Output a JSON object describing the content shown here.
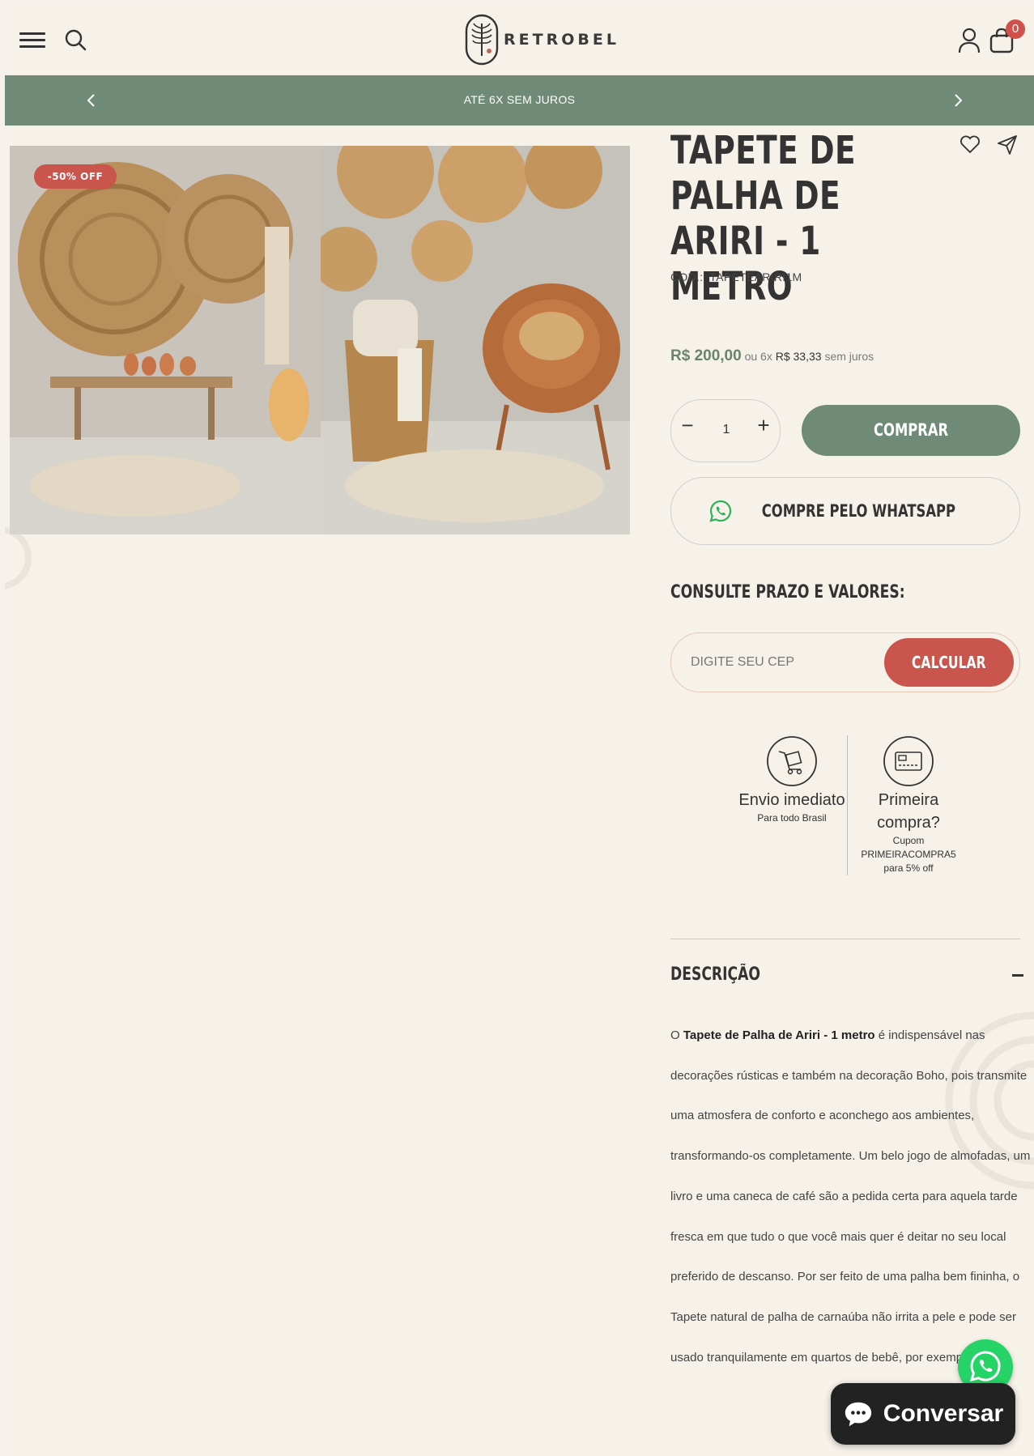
{
  "header": {
    "brand": "RETROBEL",
    "cart_count": "0",
    "icons": [
      "menu-icon",
      "search-icon",
      "user-icon",
      "bag-icon"
    ]
  },
  "announcement": {
    "text": "ATÉ 6X SEM JUROS"
  },
  "product": {
    "badge": "-50% OFF",
    "title": "TAPETE DE PALHA DE ARIRI - 1 METRO",
    "sku_label": "COD.:",
    "sku": "TAPETEARIRI1M",
    "price": "R$ 200,00",
    "installment_prefix": "ou 6x",
    "installment_value": "R$ 33,33",
    "installment_suffix": "sem juros",
    "quantity": "1",
    "buy_label": "COMPRAR",
    "whatsapp_label": "COMPRE PELO WHATSAPP"
  },
  "shipping": {
    "heading": "CONSULTE PRAZO E VALORES:",
    "cep_placeholder": "DIGITE SEU CEP",
    "calc_label": "CALCULAR"
  },
  "benefits": [
    {
      "title": "Envio imediato",
      "subtitle": "Para todo Brasil",
      "icon": "delivery-cart-icon"
    },
    {
      "title": "Primeira compra?",
      "subtitle": "Cupom PRIMEIRACOMPRA5 para 5% off",
      "icon": "credit-card-icon"
    }
  ],
  "description": {
    "heading": "DESCRIÇÃO",
    "intro": "O ",
    "product_name": "Tapete de Palha de Ariri - 1 metro",
    "body": " é indispensável nas decorações rústicas e também na decoração Boho, pois transmite uma atmosfera de conforto e aconchego aos ambientes, transformando-os completamente. Um belo jogo de almofadas, um livro e uma caneca de café são a pedida certa para aquela tarde fresca em que tudo o que você mais quer é deitar no seu local preferido de descanso. Por ser feito de uma palha bem fininha, o Tapete natural de palha de carnaúba não irrita a pele e pode ser usado tranquilamente em quartos de bebê, por exemplo."
  },
  "chat": {
    "label": "Conversar"
  },
  "colors": {
    "accent_green": "#6f8a77",
    "accent_red": "#c9554d",
    "background": "#f6f1e9",
    "whatsapp": "#25d366"
  }
}
